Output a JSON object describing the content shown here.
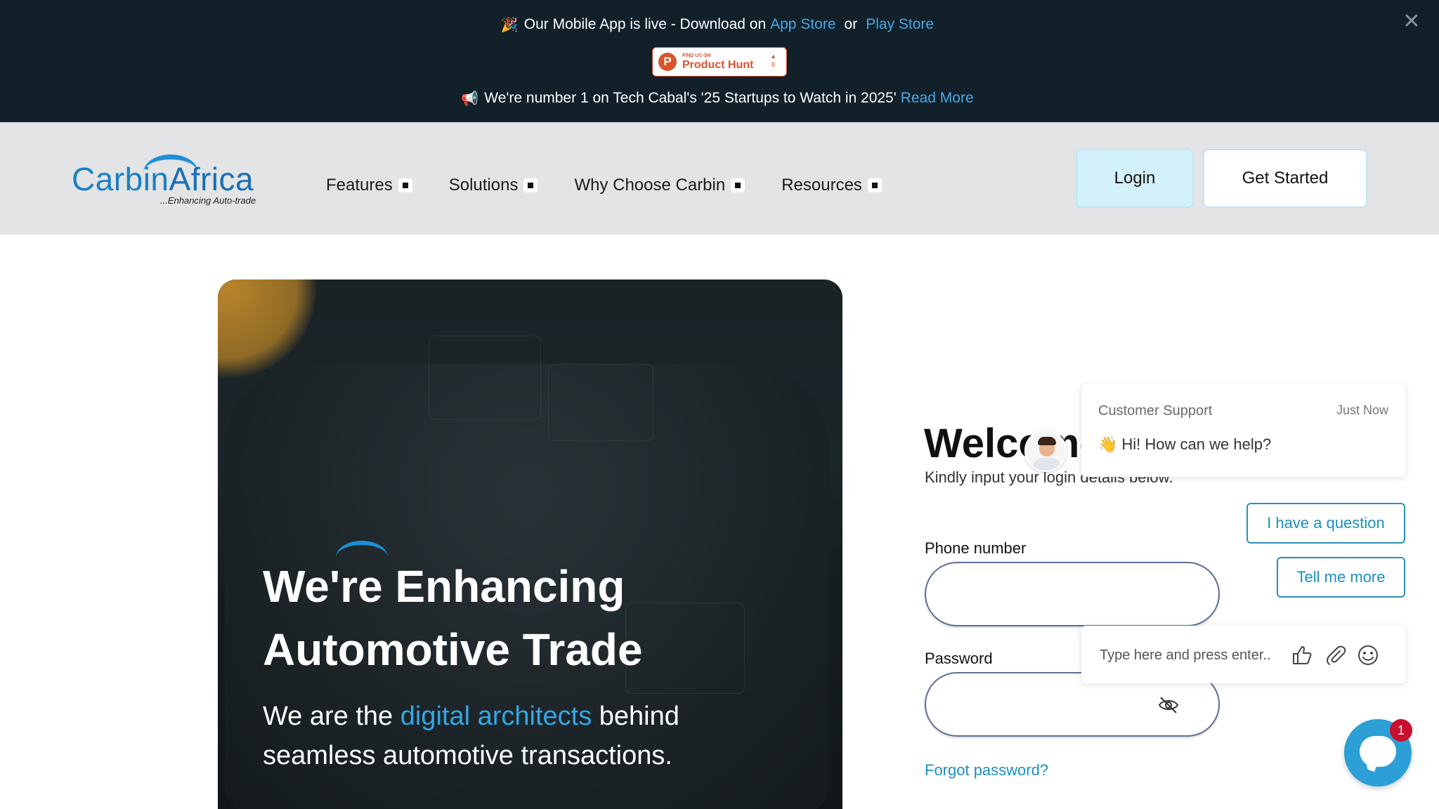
{
  "announcement": {
    "row1_emoji": "🎉",
    "row1_text": "Our Mobile App is live - Download on",
    "app_store": "App Store",
    "or": "or",
    "play_store": "Play Store",
    "product_hunt": {
      "small": "FIND US ON",
      "big": "Product Hunt",
      "votes": "8"
    },
    "row3_emoji": "📢",
    "row3_text": "We're number 1 on Tech Cabal's '25 Startups to Watch in 2025'",
    "read_more": "Read More",
    "close_icon": "close-icon"
  },
  "header": {
    "logo_text_a": "Carbin",
    "logo_text_b": "Africa",
    "logo_tagline": "...Enhancing Auto-trade",
    "nav": [
      {
        "label": "Features"
      },
      {
        "label": "Solutions"
      },
      {
        "label": "Why Choose Carbin"
      },
      {
        "label": "Resources"
      }
    ],
    "login": "Login",
    "get_started": "Get Started"
  },
  "hero": {
    "title": "We're Enhancing Automotive Trade",
    "sub_before": "We are the ",
    "sub_highlight": "digital architects",
    "sub_after": " behind seamless automotive transactions."
  },
  "login_form": {
    "welcome": "Welcome",
    "kindly": "Kindly input your login details below.",
    "phone_label": "Phone number",
    "phone_value": "",
    "password_label": "Password",
    "password_value": "",
    "forgot": "Forgot password?"
  },
  "chat": {
    "agent": "Customer Support",
    "time": "Just Now",
    "wave": "👋",
    "message": "Hi! How can we help?",
    "quick_replies": [
      "I have a question",
      "Tell me more"
    ],
    "input_placeholder": "Type here and press enter..",
    "badge": "1"
  },
  "colors": {
    "topbar": "#112029",
    "link": "#4aa8e6",
    "brand": "#1b7fc4",
    "accent": "#2b9fd6"
  }
}
